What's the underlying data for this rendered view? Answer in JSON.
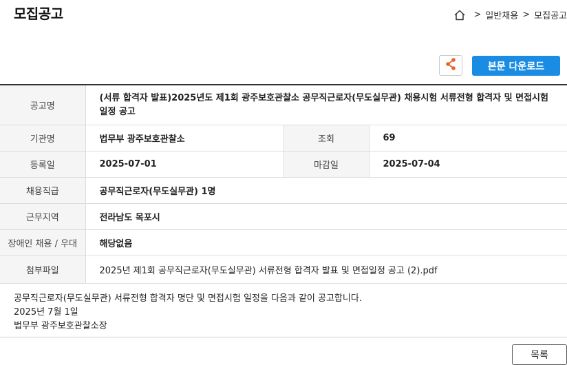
{
  "page": {
    "title": "모집공고"
  },
  "breadcrumb": {
    "items": [
      "일반채용",
      "모집공고"
    ],
    "separator": ">"
  },
  "toolbar": {
    "download_label": "본문 다운로드"
  },
  "notice": {
    "title_label": "공고명",
    "title": "(서류 합격자 발표)2025년도 제1회 광주보호관찰소 공무직근로자(무도실무관) 채용시험 서류전형 합격자 및 면접시험 일정 공고",
    "agency_label": "기관명",
    "agency": "법무부 광주보호관찰소",
    "views_label": "조회",
    "views": "69",
    "registered_label": "등록일",
    "registered": "2025-07-01",
    "deadline_label": "마감일",
    "deadline": "2025-07-04",
    "position_label": "채용직급",
    "position": "공무직근로자(무도실무관) 1명",
    "region_label": "근무지역",
    "region": "전라남도 목포시",
    "disability_label": "장애인 채용 / 우대",
    "disability": "해당없음",
    "attachment_label": "첨부파일",
    "attachment": "2025년 제1회 공무직근로자(무도실무관) 서류전형 합격자 발표 및 면접일정 공고 (2).pdf"
  },
  "content": {
    "lines": [
      "공무직근로자(무도실무관) 서류전형 합격자 명단 및 면접시험 일정을 다음과 같이 공고합니다.",
      "2025년 7월 1일",
      "법무부 광주보호관찰소장"
    ]
  },
  "footer": {
    "list_label": "목록"
  },
  "colors": {
    "accent": "#1a8ce3",
    "share_icon": "#e8622c"
  }
}
